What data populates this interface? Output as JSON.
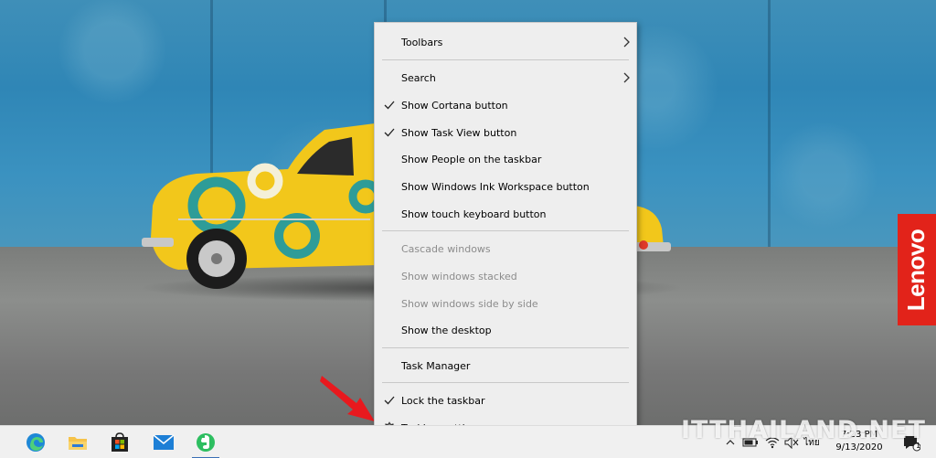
{
  "wallpaper": {
    "brand": "Lenovo"
  },
  "context_menu": {
    "items": [
      {
        "label": "Toolbars",
        "checked": false,
        "disabled": false,
        "submenu": true
      },
      {
        "label": "Search",
        "checked": false,
        "disabled": false,
        "submenu": true
      },
      {
        "label": "Show Cortana button",
        "checked": true,
        "disabled": false
      },
      {
        "label": "Show Task View button",
        "checked": true,
        "disabled": false
      },
      {
        "label": "Show People on the taskbar",
        "checked": false,
        "disabled": false
      },
      {
        "label": "Show Windows Ink Workspace button",
        "checked": false,
        "disabled": false
      },
      {
        "label": "Show touch keyboard button",
        "checked": false,
        "disabled": false
      },
      {
        "label": "Cascade windows",
        "checked": false,
        "disabled": true
      },
      {
        "label": "Show windows stacked",
        "checked": false,
        "disabled": true
      },
      {
        "label": "Show windows side by side",
        "checked": false,
        "disabled": true
      },
      {
        "label": "Show the desktop",
        "checked": false,
        "disabled": false
      },
      {
        "label": "Task Manager",
        "checked": false,
        "disabled": false
      },
      {
        "label": "Lock the taskbar",
        "checked": true,
        "disabled": false
      },
      {
        "label": "Taskbar settings",
        "checked": false,
        "disabled": false,
        "icon": "gear-icon"
      }
    ]
  },
  "taskbar": {
    "apps": [
      {
        "name": "edge-icon",
        "active": false
      },
      {
        "name": "file-explorer-icon",
        "active": false
      },
      {
        "name": "microsoft-store-icon",
        "active": false
      },
      {
        "name": "mail-icon",
        "active": false
      },
      {
        "name": "evernote-icon",
        "active": true
      }
    ],
    "tray": {
      "language": "ไทย",
      "time": "7:23 PM",
      "date": "9/13/2020",
      "notification_count": "1"
    }
  },
  "watermark": "ITTHAILAND.NET",
  "colors": {
    "menu_bg": "#eeeeee",
    "taskbar_bg": "#f0f0f0",
    "accent": "#3a6fb5",
    "lenovo_red": "#e2231a",
    "arrow_red": "#e8191e"
  }
}
